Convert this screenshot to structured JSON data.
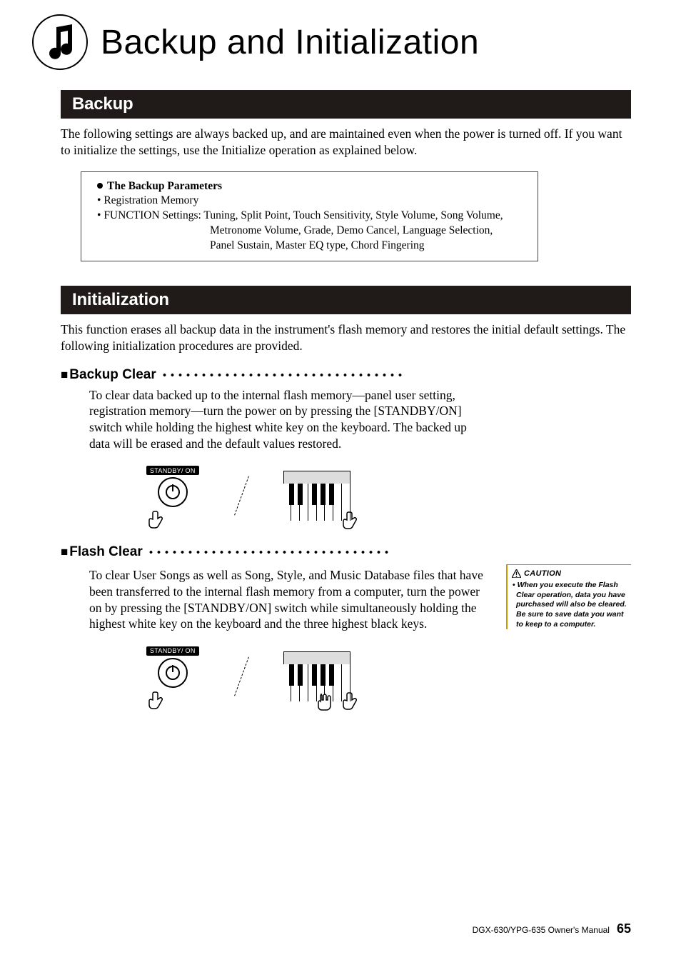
{
  "page_title": "Backup and Initialization",
  "sections": {
    "backup": {
      "bar": "Backup",
      "intro": "The following settings are always backed up, and are maintained even when the power is turned off. If you want to initialize the settings, use the Initialize operation as explained below.",
      "param_title": "The Backup Parameters",
      "param_bullets": [
        "Registration Memory",
        "FUNCTION Settings: Tuning, Split Point, Touch Sensitivity, Style Volume, Song Volume,"
      ],
      "param_hang": [
        "Metronome Volume, Grade, Demo Cancel, Language Selection,",
        "Panel Sustain, Master EQ type, Chord Fingering"
      ]
    },
    "init": {
      "bar": "Initialization",
      "intro": "This function erases all backup data in the instrument's flash memory and restores the initial default settings. The following initialization procedures are provided.",
      "backup_clear": {
        "heading": "Backup Clear",
        "text": "To clear data backed up to the internal flash memory—panel user setting, registration memory—turn the power on by pressing the [STANDBY/ON] switch while holding the highest white key on the keyboard. The backed up data will be erased and the default values restored."
      },
      "flash_clear": {
        "heading": "Flash Clear",
        "text": "To clear User Songs as well as Song, Style, and Music Database files that have been transferred to the internal flash memory from a computer, turn the power on by pressing the [STANDBY/ON] switch while simultaneously holding the highest white key on the keyboard and the three highest black keys.",
        "caution_title": "CAUTION",
        "caution_body": "When you execute the Flash Clear operation, data you have purchased will also be cleared. Be sure to save data you want to keep to a computer."
      }
    }
  },
  "standby_label": "STANDBY/    ON",
  "footer": {
    "manual": "DGX-630/YPG-635  Owner's Manual",
    "page": "65"
  }
}
